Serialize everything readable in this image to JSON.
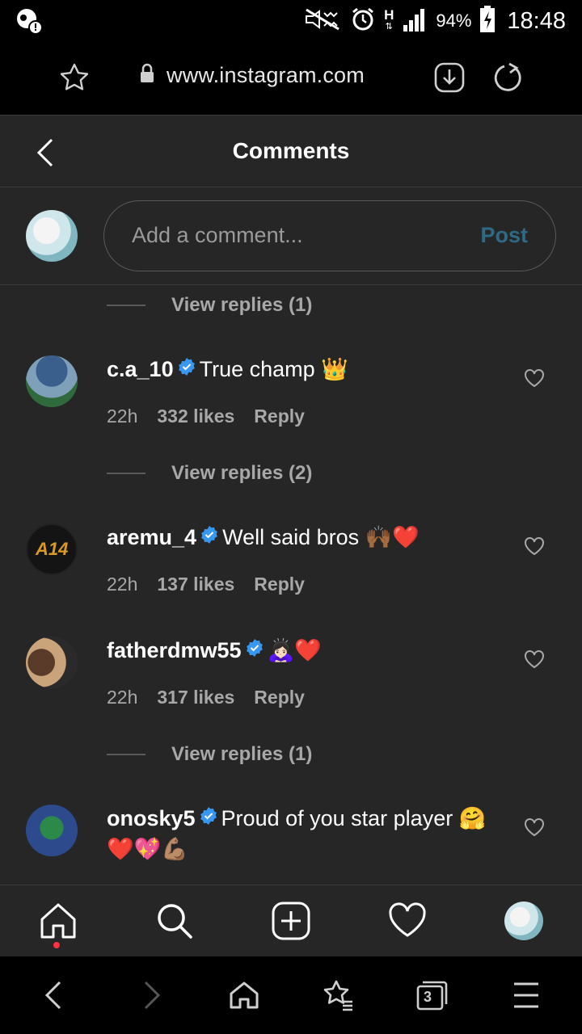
{
  "status": {
    "battery": "94%",
    "time": "18:48",
    "network": "H"
  },
  "browser": {
    "url": "www.instagram.com"
  },
  "header": {
    "title": "Comments"
  },
  "compose": {
    "placeholder": "Add a comment...",
    "post_label": "Post"
  },
  "replies_labels": [
    "View replies (1)",
    "View replies (2)",
    "View replies (1)"
  ],
  "comments": [
    {
      "user": "c.a_10",
      "text": "True champ 👑",
      "time": "22h",
      "likes": "332 likes",
      "reply": "Reply"
    },
    {
      "user": "aremu_4",
      "text": "Well said bros 🙌🏾❤️",
      "time": "22h",
      "likes": "137 likes",
      "reply": "Reply",
      "avatar_text": "A14"
    },
    {
      "user": "fatherdmw55",
      "text": "🙇🏻‍♀️❤️",
      "time": "22h",
      "likes": "317 likes",
      "reply": "Reply"
    },
    {
      "user": "onosky5",
      "text": "Proud of you star player 🤗 ❤️💖💪🏽"
    }
  ],
  "tabs": [
    "home-icon",
    "search-icon",
    "new-post-icon",
    "activity-icon",
    "profile-avatar"
  ],
  "android_nav": {
    "tabs_count": "3"
  },
  "colors": {
    "background": "#262626",
    "post_link": "#2e6a86",
    "verified": "#3897f0",
    "notification_dot": "#ff3040"
  }
}
